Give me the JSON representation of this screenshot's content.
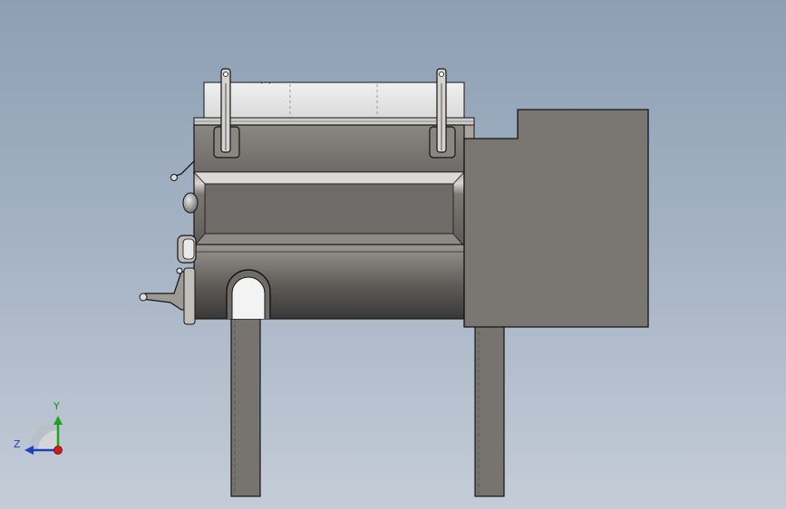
{
  "triad": {
    "y_label": "Y",
    "z_label": "Z",
    "colors": {
      "y": "#1fa31f",
      "z": "#1c3fbd",
      "x_origin": "#d11a1a"
    }
  },
  "colors": {
    "background_top": "#8e9fb4",
    "background_bottom": "#c4ccd7",
    "body_gray": "#7a7672",
    "outline": "#141414",
    "cover": "#e6e6e6"
  }
}
